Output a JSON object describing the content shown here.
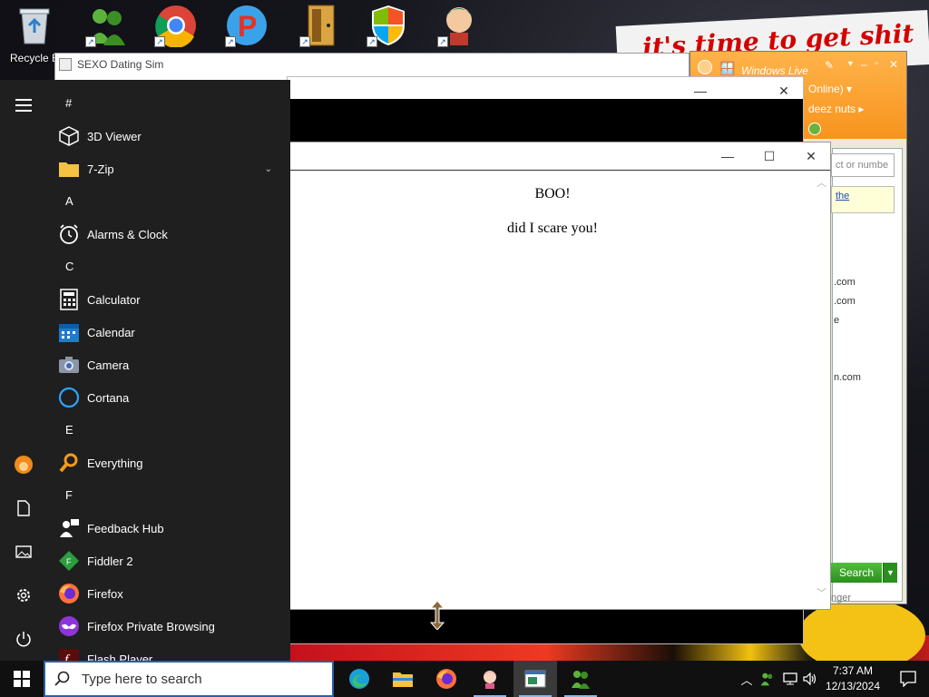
{
  "desktop": {
    "icons": [
      {
        "label": "Recycle B",
        "icon": "recycle-bin-icon"
      },
      {
        "label": "",
        "icon": "msn-messenger-icon"
      },
      {
        "label": "",
        "icon": "chrome-icon"
      },
      {
        "label": "",
        "icon": "p-app-icon"
      },
      {
        "label": "",
        "icon": "door-app-icon"
      },
      {
        "label": "",
        "icon": "windows-shield-icon"
      },
      {
        "label": "",
        "icon": "game-character-icon"
      }
    ],
    "wallpaper_text": "it's time to get shit"
  },
  "windows": {
    "msn_main": {
      "title": "SEXO Dating Sim"
    },
    "windows_live": {
      "title": "Windows Live",
      "status": "Online) ▾",
      "nickname": "deez nuts ▸",
      "search_placeholder": "ct or numbe",
      "ad_text": "the",
      "contacts": [
        ".com",
        ".com",
        "e",
        "n.com"
      ],
      "search_button": "Search",
      "footer": "nger"
    },
    "boo": {
      "heading": "BOO!",
      "message": "did I scare you!"
    }
  },
  "start_menu": {
    "groups": [
      {
        "letter": "#",
        "apps": [
          {
            "label": "3D Viewer",
            "icon": "3d-viewer-icon"
          },
          {
            "label": "7-Zip",
            "icon": "folder-icon",
            "expandable": true
          }
        ]
      },
      {
        "letter": "A",
        "apps": [
          {
            "label": "Alarms & Clock",
            "icon": "alarm-clock-icon"
          }
        ]
      },
      {
        "letter": "C",
        "apps": [
          {
            "label": "Calculator",
            "icon": "calculator-icon"
          },
          {
            "label": "Calendar",
            "icon": "calendar-icon"
          },
          {
            "label": "Camera",
            "icon": "camera-icon"
          },
          {
            "label": "Cortana",
            "icon": "cortana-icon"
          }
        ]
      },
      {
        "letter": "E",
        "apps": [
          {
            "label": "Everything",
            "icon": "everything-search-icon"
          }
        ]
      },
      {
        "letter": "F",
        "apps": [
          {
            "label": "Feedback Hub",
            "icon": "feedback-hub-icon"
          },
          {
            "label": "Fiddler 2",
            "icon": "fiddler-icon"
          },
          {
            "label": "Firefox",
            "icon": "firefox-icon"
          },
          {
            "label": "Firefox Private Browsing",
            "icon": "firefox-private-icon"
          },
          {
            "label": "Flash Player",
            "icon": "flash-player-icon"
          }
        ]
      }
    ],
    "rail": [
      "hamburger-menu-icon",
      "user-avatar-icon",
      "documents-icon",
      "pictures-icon",
      "settings-icon",
      "power-icon"
    ]
  },
  "taskbar": {
    "search_placeholder": "Type here to search",
    "pinned": [
      "edge-icon",
      "file-explorer-icon",
      "firefox-icon",
      "anime-app-icon",
      "window-app-icon",
      "msn-messenger-icon"
    ],
    "clock_time": "7:37 AM",
    "clock_date": "12/13/2024"
  },
  "colors": {
    "accent": "#0078d4",
    "start_bg": "#1f1f1f",
    "taskbar_bg": "#101010",
    "msn_orange": "#f7941d"
  }
}
